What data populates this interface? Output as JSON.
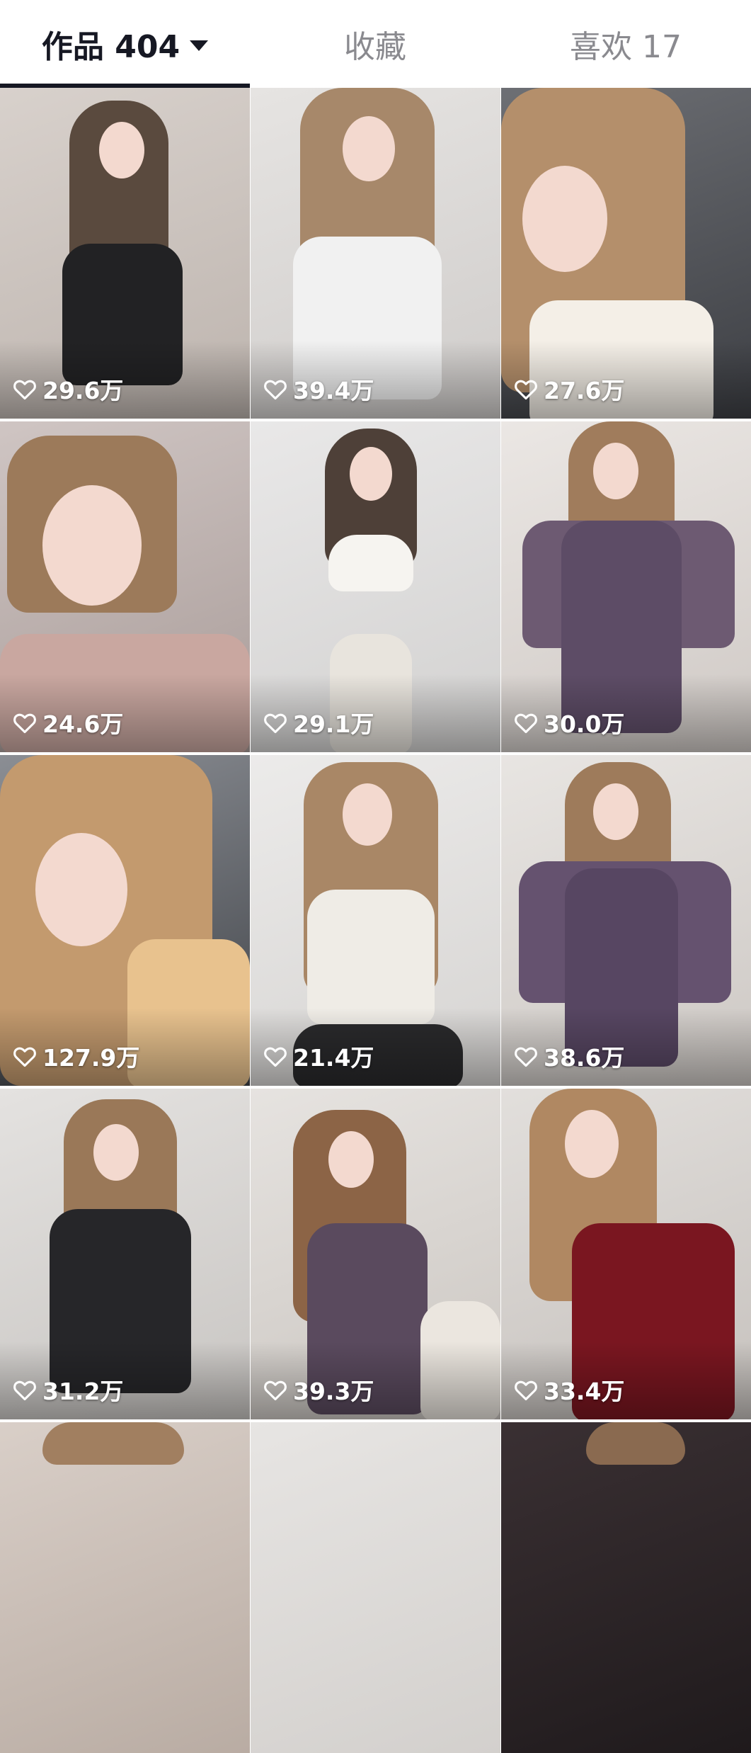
{
  "tabs": [
    {
      "label": "作品 404",
      "active": true,
      "has_dropdown": true
    },
    {
      "label": "收藏",
      "active": false
    },
    {
      "label": "喜欢 17",
      "active": false
    }
  ],
  "icons": {
    "like": "heart-outline-icon",
    "dropdown": "caret-down-icon"
  },
  "colors": {
    "active_tab": "#161823",
    "inactive_tab": "#8a8a8f",
    "overlay_text": "#ffffff"
  },
  "grid": {
    "items": [
      {
        "likes": "29.6万"
      },
      {
        "likes": "39.4万"
      },
      {
        "likes": "27.6万"
      },
      {
        "likes": "24.6万"
      },
      {
        "likes": "29.1万"
      },
      {
        "likes": "30.0万"
      },
      {
        "likes": "127.9万"
      },
      {
        "likes": "21.4万"
      },
      {
        "likes": "38.6万"
      },
      {
        "likes": "31.2万"
      },
      {
        "likes": "39.3万"
      },
      {
        "likes": "33.4万"
      }
    ]
  }
}
